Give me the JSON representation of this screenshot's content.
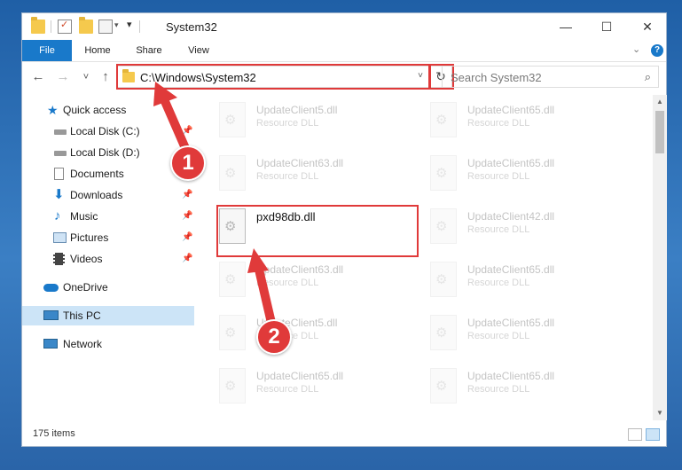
{
  "window": {
    "title": "System32"
  },
  "ribbon": {
    "file": "File",
    "home": "Home",
    "share": "Share",
    "view": "View",
    "help": "?"
  },
  "window_controls": {
    "minimize": "—",
    "maximize": "☐",
    "close": "✕"
  },
  "navigation": {
    "back": "←",
    "forward": "→",
    "recent": "˅",
    "up": "↑"
  },
  "address": {
    "path": "C:\\Windows\\System32",
    "dropdown": "˅",
    "refresh": "↻"
  },
  "search": {
    "placeholder": "Search System32",
    "icon": "⌕"
  },
  "sidebar": {
    "quick_access": "Quick access",
    "local_disk_c": "Local Disk (C:)",
    "local_disk_d": "Local Disk (D:)",
    "documents": "Documents",
    "downloads": "Downloads",
    "music": "Music",
    "pictures": "Pictures",
    "videos": "Videos",
    "onedrive": "OneDrive",
    "this_pc": "This PC",
    "network": "Network",
    "pin": "📌"
  },
  "files": {
    "left": [
      {
        "name": "UpdateClient5.dll",
        "type": "Resource DLL"
      },
      {
        "name": "UpdateClient63.dll",
        "type": "Resource DLL"
      },
      {
        "name": "pxd98db.dll",
        "type": ""
      },
      {
        "name": "UpdateClient63.dll",
        "type": "Resource DLL"
      },
      {
        "name": "UpdateClient5.dll",
        "type": "Resource DLL"
      },
      {
        "name": "UpdateClient65.dll",
        "type": "Resource DLL"
      }
    ],
    "right": [
      {
        "name": "UpdateClient65.dll",
        "type": "Resource DLL"
      },
      {
        "name": "UpdateClient65.dll",
        "type": "Resource DLL"
      },
      {
        "name": "UpdateClient42.dll",
        "type": "Resource DLL"
      },
      {
        "name": "UpdateClient65.dll",
        "type": "Resource DLL"
      },
      {
        "name": "UpdateClient65.dll",
        "type": "Resource DLL"
      },
      {
        "name": "UpdateClient65.dll",
        "type": "Resource DLL"
      }
    ]
  },
  "statusbar": {
    "count": "175 items"
  },
  "callouts": {
    "step1": "1",
    "step2": "2"
  },
  "colors": {
    "accent": "#1979ca",
    "highlight": "#e03a3a",
    "selected": "#cce4f7"
  }
}
